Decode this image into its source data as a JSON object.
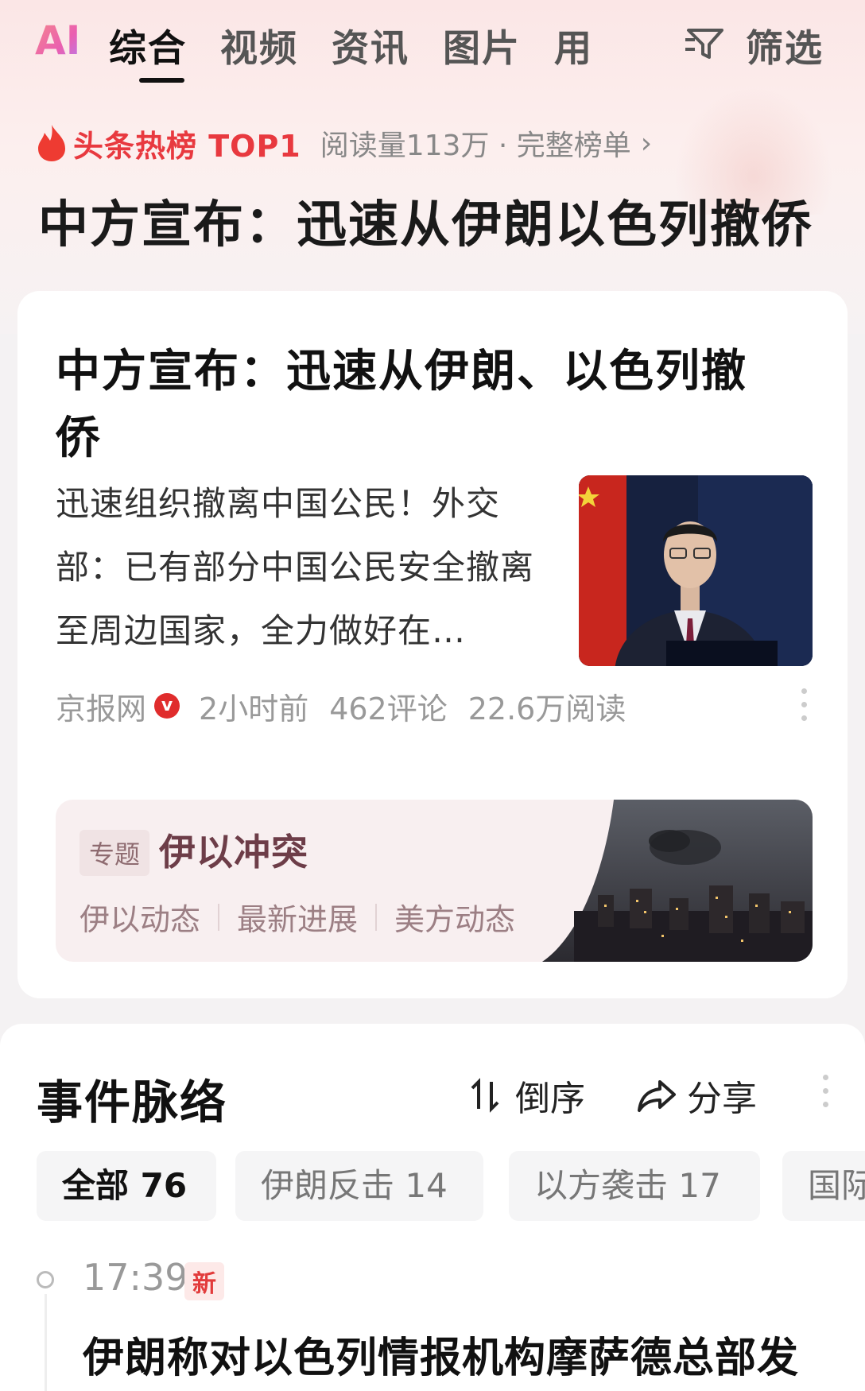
{
  "nav": {
    "ai": "AI",
    "tabs": [
      "综合",
      "视频",
      "资讯",
      "图片",
      "用"
    ],
    "filter_label": "筛选"
  },
  "hot": {
    "title": "头条热榜 TOP1",
    "meta": "阅读量113万 · 完整榜单",
    "chevron": "›"
  },
  "main_title": "中方宣布：迅速从伊朗以色列撤侨",
  "article": {
    "title": "中方宣布：迅速从伊朗、以色列撤侨",
    "summary": "迅速组织撤离中国公民！外交部：已有部分中国公民安全撤离至周边国家，全力做好在…",
    "source": "京报网",
    "verified": "v",
    "time": "2小时前",
    "comments": "462评论",
    "reads": "22.6万阅读"
  },
  "topic": {
    "tag": "专题",
    "title": "伊以冲突",
    "links": [
      "伊以动态",
      "最新进展",
      "美方动态"
    ]
  },
  "events": {
    "title": "事件脉络",
    "sort_label": "倒序",
    "share_label": "分享",
    "chips": [
      {
        "label": "全部 76"
      },
      {
        "label": "伊朗反击 14"
      },
      {
        "label": "以方袭击 17"
      },
      {
        "label": "国际"
      }
    ],
    "first": {
      "time": "17:39",
      "badge": "新",
      "headline": "伊朗称对以色列情报机构摩萨德总部发"
    }
  },
  "colors": {
    "accent_red": "#e8393f",
    "topic_title": "#6d3d48"
  },
  "icons": [
    "flame-icon",
    "filter-icon",
    "chevron-right-icon",
    "verified-icon",
    "more-icon",
    "sort-icon",
    "share-icon"
  ]
}
